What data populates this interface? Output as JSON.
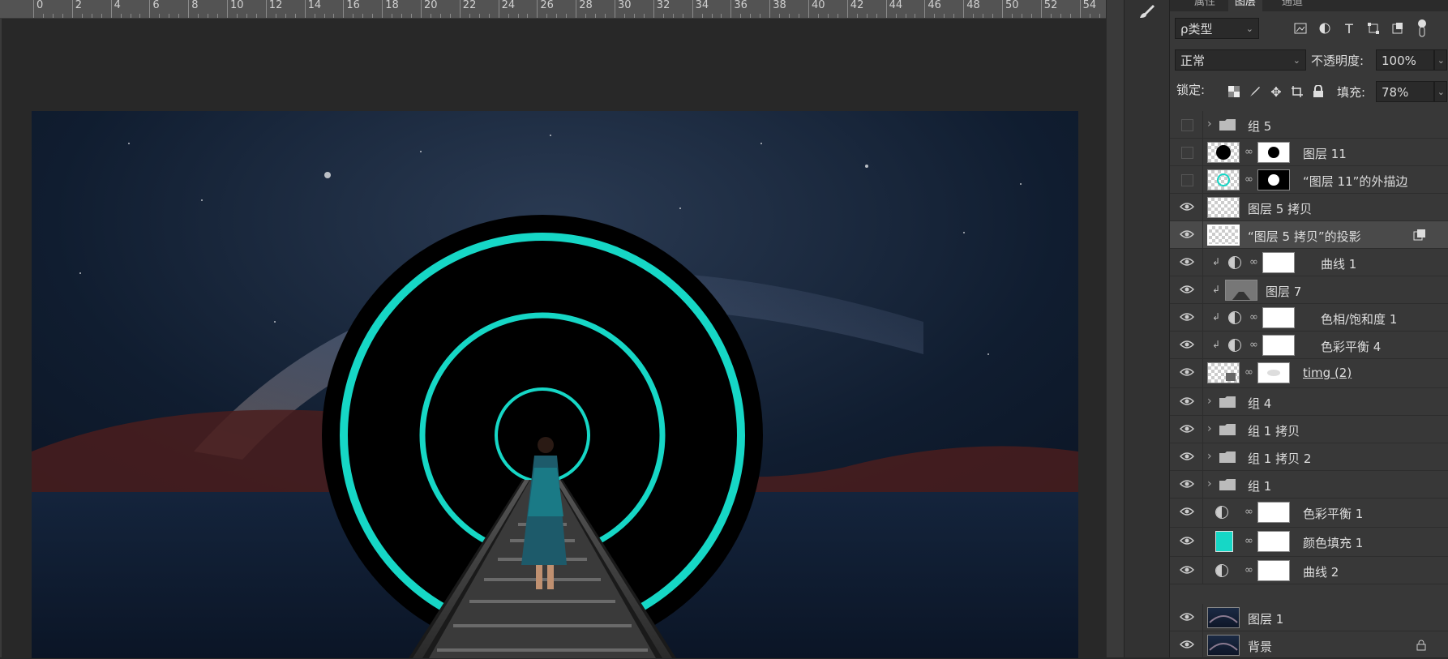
{
  "ruler": {
    "ticks": [
      "0",
      "2",
      "4",
      "6",
      "8",
      "10",
      "12",
      "14",
      "16",
      "18",
      "20",
      "22",
      "24",
      "26",
      "28",
      "30",
      "32",
      "34",
      "36",
      "38",
      "40",
      "42",
      "44",
      "46",
      "48",
      "50",
      "52",
      "54"
    ]
  },
  "panel": {
    "tabs": [
      "属性",
      "图层",
      "通道"
    ],
    "filter": {
      "label": "ρ类型"
    },
    "blend": {
      "mode": "正常",
      "opacity_label": "不透明度:",
      "opacity": "100%"
    },
    "lock": {
      "label": "锁定:",
      "fill_label": "填充:",
      "fill": "78%"
    },
    "layers": [
      {
        "name": "组 5",
        "visible": false
      },
      {
        "name": "图层 11",
        "visible": false
      },
      {
        "name": "“图层 11”的外描边",
        "visible": false
      },
      {
        "name": "图层 5 拷贝",
        "visible": true
      },
      {
        "name": "“图层 5 拷贝”的投影",
        "visible": true
      },
      {
        "name": "曲线 1",
        "visible": true
      },
      {
        "name": "图层 7",
        "visible": true
      },
      {
        "name": "色相/饱和度 1",
        "visible": true
      },
      {
        "name": "色彩平衡 4",
        "visible": true
      },
      {
        "name": "timg (2)",
        "visible": true
      },
      {
        "name": "组 4",
        "visible": true
      },
      {
        "name": "组 1 拷贝",
        "visible": true
      },
      {
        "name": "组 1 拷贝 2",
        "visible": true
      },
      {
        "name": "组 1",
        "visible": true
      },
      {
        "name": "色彩平衡 1",
        "visible": true
      },
      {
        "name": "颜色填充 1",
        "visible": true
      },
      {
        "name": "曲线 2",
        "visible": true
      },
      {
        "name": "图层 1",
        "visible": true
      },
      {
        "name": "背景",
        "visible": true
      }
    ]
  },
  "colors": {
    "accent": "#16d7c6",
    "sky": "#0e1a2b",
    "dune": "#4a1d1d",
    "ground": "#0f1d33"
  }
}
